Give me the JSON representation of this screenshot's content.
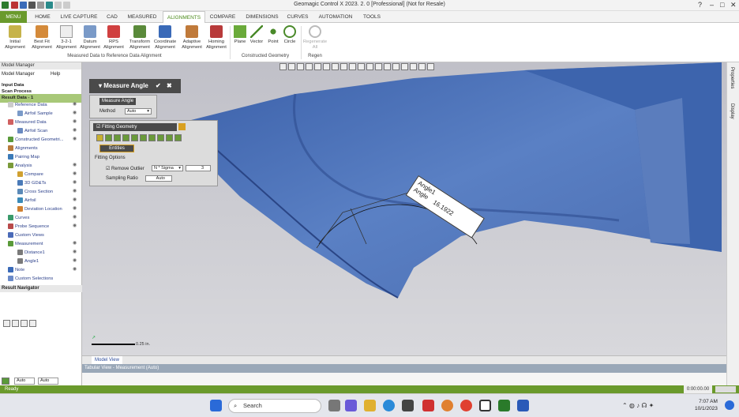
{
  "title": "Geomagic Control X 2023. 2. 0 [Professional] (Not for Resale)",
  "tabs": {
    "menu": "MENU",
    "home": "HOME",
    "live": "LIVE CAPTURE",
    "cad": "CAD",
    "measured": "MEASURED",
    "alignments": "ALIGNMENTS",
    "compare": "COMPARE",
    "dimensions": "DIMENSIONS",
    "curves": "CURVES",
    "automation": "AUTOMATION",
    "tools": "TOOLS"
  },
  "ribbon": {
    "initial": [
      "Initial",
      "Alignment"
    ],
    "bestfit": [
      "Best Fit",
      "Alignment"
    ],
    "three21": [
      "3-2-1",
      "Alignment"
    ],
    "datum": [
      "Datum",
      "Alignment"
    ],
    "rps": [
      "RPS",
      "Alignment"
    ],
    "transform": [
      "Transform",
      "Alignment"
    ],
    "coordinate": [
      "Coordinate",
      "Alignment"
    ],
    "adaptive": [
      "Adaptive",
      "Alignment"
    ],
    "homing": [
      "Homing",
      "Alignment"
    ],
    "plane": "Plane",
    "vector": "Vector",
    "point": "Point",
    "circle": "Circle",
    "regen": [
      "Regenerate",
      "All"
    ],
    "grp_measured": "Measured Data to Reference Data Alignment",
    "grp_constructed": "Constructed Geometry",
    "grp_regen": "Regen"
  },
  "model_manager": {
    "header": "Model Manager",
    "tab_mm": "Model Manager",
    "tab_help": "Help",
    "input_data": "Input Data",
    "scan_process": "Scan Process",
    "result_data": "Result Data - 1",
    "items": [
      "Reference Data",
      "Airfoil Sample",
      "Measured Data",
      "Airfoil Scan",
      "Constructed Geometri...",
      "Alignments",
      "Pairing Map",
      "Analysis",
      "Compare",
      "3D GD&Ts",
      "Cross Section",
      "Airfoil",
      "Deviation Location",
      "Curves",
      "Probe Sequence",
      "Custom Views",
      "Measurement",
      "Distance1",
      "Angle1",
      "Note",
      "Custom Selections"
    ],
    "result_navigator": "Result Navigator"
  },
  "dialog": {
    "title": "Measure Angle",
    "sub": "Measure Angle",
    "method_label": "Method",
    "method_value": "Auto",
    "fitting": "Fitting Geometry",
    "entities": "Entities",
    "fitting_options": "Fitting Options",
    "remove_outlier": "Remove Outlier",
    "outlier_mode": "N * Sigma",
    "outlier_value": "3",
    "sampling_ratio": "Sampling Ratio",
    "sampling_value": "Auto"
  },
  "annotation": {
    "name": "Angle1",
    "label": "Angle",
    "value": "16.1922"
  },
  "scale_label": "0.25 in.",
  "viewport_tab": "Model View",
  "tabular": "Tabular View - Measurement (Auto)",
  "right_tabs": {
    "properties": "Properties",
    "display": "Display"
  },
  "lower": {
    "sel1": "Auto",
    "sel2": "Auto"
  },
  "status": {
    "ready": "Ready",
    "timer": "0:00:00.00"
  },
  "taskbar": {
    "search": "Search",
    "time": "7:07 AM",
    "date": "10/1/2023"
  },
  "colors": {
    "accent": "#6a9a2c",
    "mesh": "#4f74b8"
  }
}
